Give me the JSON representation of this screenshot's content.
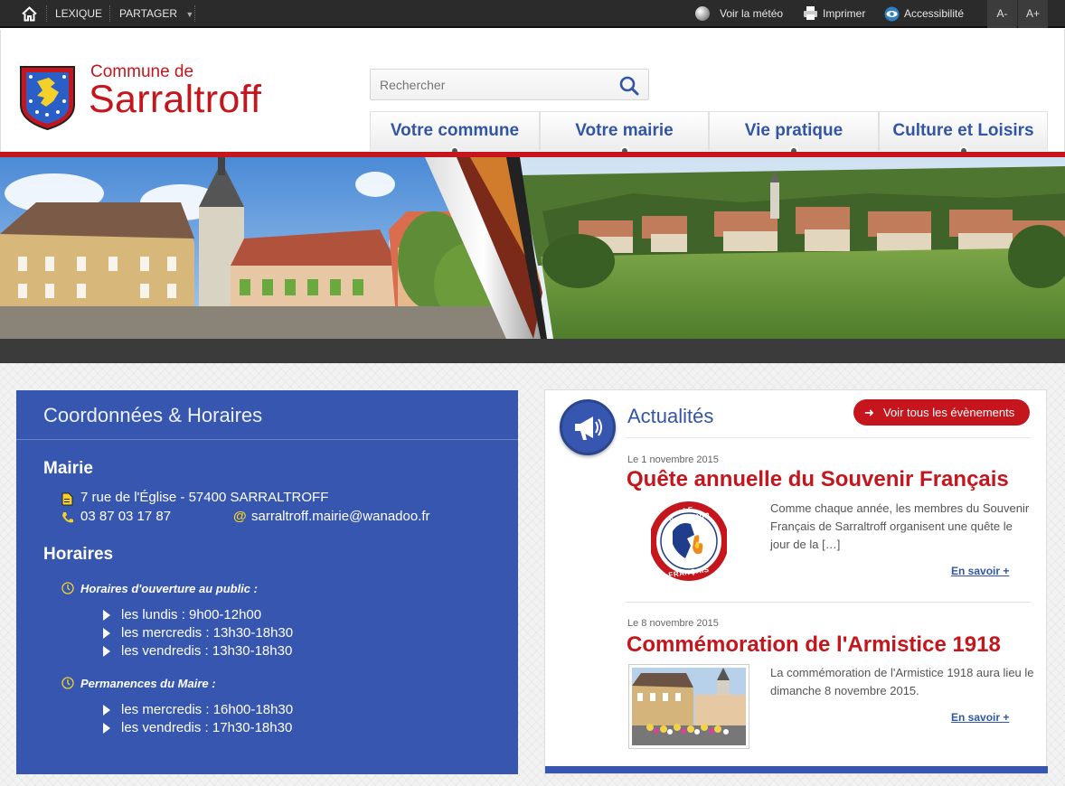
{
  "topbar": {
    "home_icon": "home-icon",
    "lexique": "LEXIQUE",
    "partager": "PARTAGER",
    "meteo": "Voir la météo",
    "imprimer": "Imprimer",
    "accessibilite": "Accessibilité",
    "font_minus": "A-",
    "font_plus": "A+"
  },
  "header": {
    "brand_small": "Commune de",
    "brand_big": "Sarraltroff",
    "search_placeholder": "Rechercher",
    "nav": [
      {
        "label": "Votre commune"
      },
      {
        "label": "Votre mairie"
      },
      {
        "label": "Vie pratique"
      },
      {
        "label": "Culture et Loisirs"
      }
    ]
  },
  "colors": {
    "brand_red": "#c4161c",
    "brand_blue": "#3656b0",
    "nav_text": "#3355a6"
  },
  "coordonnees": {
    "title": "Coordonnées & Horaires",
    "mairie_heading": "Mairie",
    "address": "7 rue de l'Église - 57400 SARRALTROFF",
    "phone": "03 87 03 17 87",
    "email": "sarraltroff.mairie@wanadoo.fr",
    "horaires_heading": "Horaires",
    "public_heading": "Horaires d'ouverture au public :",
    "public_hours": [
      "les lundis : 9h00-12h00",
      "les mercredis : 13h30-18h30",
      "les vendredis : 13h30-18h30"
    ],
    "maire_heading": "Permanences du Maire :",
    "maire_hours": [
      "les mercredis : 16h00-18h30",
      "les vendredis : 17h30-18h30"
    ]
  },
  "actualites": {
    "title": "Actualités",
    "all_button": "Voir tous les évènements",
    "items": [
      {
        "date": "Le 1 novembre 2015",
        "title": "Quête annuelle du Souvenir Français",
        "text": "Comme chaque année, les membres du Souvenir Français de Sarraltroff organisent une quête le jour de la […]",
        "more": "En savoir +",
        "logo_top": "LE SOUVENIR",
        "logo_bottom": "FRANÇAIS"
      },
      {
        "date": "Le 8 novembre 2015",
        "title": "Commémoration de l'Armistice 1918",
        "text": "La commémoration de l'Armistice 1918 aura lieu le dimanche 8 novembre 2015.",
        "more": "En savoir +"
      }
    ]
  }
}
